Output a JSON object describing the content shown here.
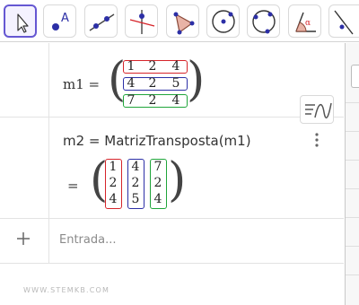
{
  "toolbar": {
    "tools": [
      {
        "name": "move",
        "icon": "arrow-cursor-icon",
        "active": true
      },
      {
        "name": "point",
        "icon": "point-icon"
      },
      {
        "name": "line",
        "icon": "line-icon"
      },
      {
        "name": "perpendicular-line",
        "icon": "perpendicular-line-icon"
      },
      {
        "name": "polygon",
        "icon": "polygon-icon"
      },
      {
        "name": "circle-center-point",
        "icon": "circle-center-icon"
      },
      {
        "name": "circle-three-points",
        "icon": "circle-three-points-icon"
      },
      {
        "name": "angle",
        "icon": "angle-icon"
      },
      {
        "name": "reflect",
        "icon": "reflect-line-icon"
      }
    ],
    "point_label": "A",
    "angle_label": "α",
    "accent_color": "#6557d2"
  },
  "algebra": {
    "m1_label": "m1  =",
    "m1_rows": [
      [
        "1",
        "2",
        "4"
      ],
      [
        "4",
        "2",
        "5"
      ],
      [
        "7",
        "2",
        "4"
      ]
    ],
    "m2_command": "m2 = MatrizTransposta(m1)",
    "m2_equals": "=",
    "m2_cols": [
      [
        "1",
        "2",
        "4"
      ],
      [
        "4",
        "2",
        "5"
      ],
      [
        "7",
        "2",
        "4"
      ]
    ],
    "input_placeholder": "Entrada...",
    "highlight_colors": [
      "#d6242a",
      "#2c2fa6",
      "#1fa53a"
    ]
  },
  "watermark": "WWW.STEMKB.COM"
}
